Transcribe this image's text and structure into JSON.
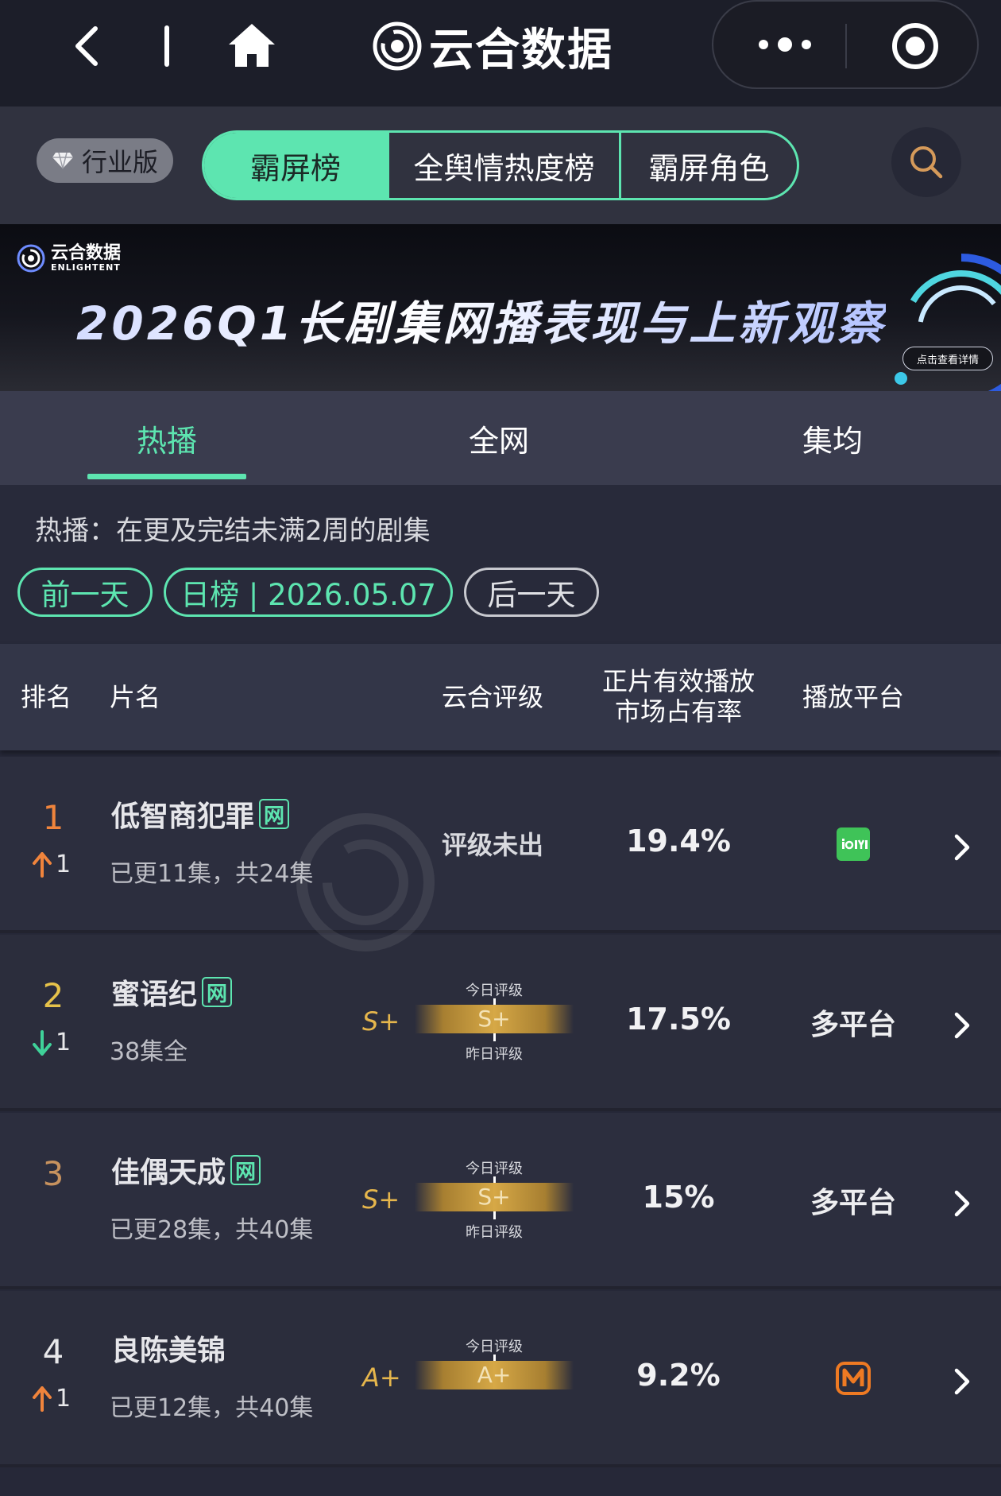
{
  "nav": {
    "title": "云合数据"
  },
  "filter": {
    "industry_label": "行业版",
    "segments": [
      "霸屏榜",
      "全舆情热度榜",
      "霸屏角色"
    ]
  },
  "banner": {
    "logo_text": "云合数据",
    "logo_sub": "ENLIGHTENT",
    "title": "2026Q1长剧集网播表现与上新观察",
    "detail_button": "点击查看详情"
  },
  "tabs": [
    "热播",
    "全网",
    "集均"
  ],
  "description": "热播：在更及完结未满2周的剧集",
  "date_nav": {
    "prev": "前一天",
    "current": "日榜 | 2026.05.07",
    "next": "后一天"
  },
  "table": {
    "headers": {
      "rank": "排名",
      "name": "片名",
      "rating": "云合评级",
      "share_line1": "正片有效播放",
      "share_line2": "市场占有率",
      "platform": "播放平台"
    },
    "rating_today_label": "今日评级",
    "rating_yesterday_label": "昨日评级",
    "net_badge": "网",
    "rows": [
      {
        "rank": "1",
        "rank_color": "#f0843c",
        "delta_dir": "up",
        "delta": "1",
        "name": "低智商犯罪",
        "net": true,
        "sub": "已更11集，共24集",
        "rating_na": "评级未出",
        "share": "19.4%",
        "platform": "",
        "platform_icon": "iqiyi-icon"
      },
      {
        "rank": "2",
        "rank_color": "#e6c24a",
        "delta_dir": "down",
        "delta": "1",
        "name": "蜜语纪",
        "net": true,
        "sub": "38集全",
        "grade": "S+",
        "today": "S+",
        "show_yesterday": true,
        "share": "17.5%",
        "platform": "多平台"
      },
      {
        "rank": "3",
        "rank_color": "#c7925e",
        "delta_dir": "",
        "delta": "",
        "name": "佳偶天成",
        "net": true,
        "sub": "已更28集，共40集",
        "grade": "S+",
        "today": "S+",
        "show_yesterday": true,
        "share": "15%",
        "platform": "多平台"
      },
      {
        "rank": "4",
        "rank_color": "#e8e8ea",
        "delta_dir": "up",
        "delta": "1",
        "name": "良陈美锦",
        "net": false,
        "sub": "已更12集，共40集",
        "grade": "A+",
        "today": "A+",
        "show_yesterday": false,
        "share": "9.2%",
        "platform": "",
        "platform_icon": "mango-tv-icon"
      }
    ]
  },
  "colors": {
    "accent": "#5de5b0",
    "up": "#f0843c",
    "down": "#3fd199",
    "gold": "#e6b64c"
  }
}
